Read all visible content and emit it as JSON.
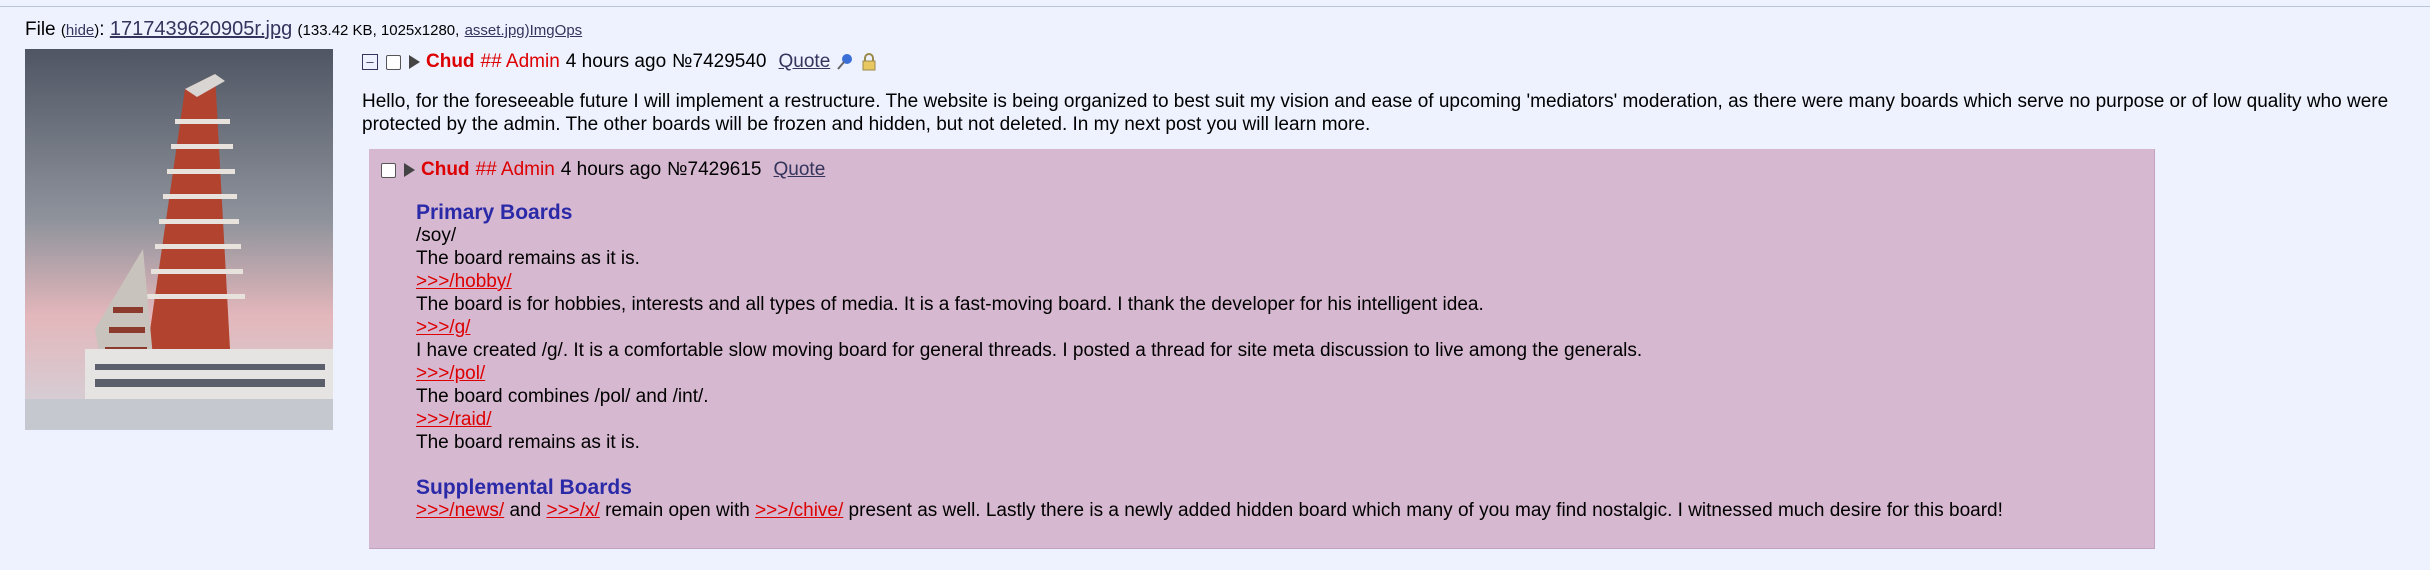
{
  "file": {
    "label": "File",
    "hide_link": "hide",
    "filename": "1717439620905r.jpg",
    "meta": "(133.42 KB, 1025x1280,",
    "asset_link": "asset.jpg)",
    "imgops": "ImgOps"
  },
  "op": {
    "hide_glyph": "–",
    "name": "Chud",
    "capcode": "## Admin",
    "date": "4 hours ago",
    "number": "№7429540",
    "quote_label": "Quote",
    "sticky_icon": "pin-icon",
    "locked_icon": "lock-icon",
    "message": "Hello, for the foreseeable future I will implement a restructure. The website is being organized to best suit my vision and ease of upcoming 'mediators' moderation, as there were many boards which serve no purpose or of low quality who were protected by the admin. The other boards will be frozen and hidden, but not deleted. In my next post you will learn more."
  },
  "reply": {
    "name": "Chud",
    "capcode": "## Admin",
    "date": "4 hours ago",
    "number": "№7429615",
    "quote_label": "Quote",
    "primary_heading": "Primary Boards",
    "soy": "/soy/",
    "soy_desc": "The board remains as it is.",
    "hobby_link": ">>>/hobby/",
    "hobby_desc": "The board is for hobbies, interests and all types of media. It is a fast-moving board. I thank the developer for his intelligent idea.",
    "g_link": ">>>/g/",
    "g_desc": "I have created /g/. It is a comfortable slow moving board for general threads. I posted a thread for site meta discussion to live among the generals.",
    "pol_link": ">>>/pol/",
    "pol_desc": "The board combines /pol/ and /int/.",
    "raid_link": ">>>/raid/",
    "raid_desc": "The board remains as it is.",
    "supplemental_heading": "Supplemental Boards",
    "news_link": ">>>/news/",
    "and_text": " and ",
    "x_link": ">>>/x/",
    "remain_text": " remain open with ",
    "chive_link": ">>>/chive/",
    "closing_text": " present as well. Lastly there is a newly added hidden board which many of you may find nostalgic. I witnessed much desire for this board!"
  },
  "colors": {
    "background": "#eef2ff",
    "reply_background": "#d6b8d0",
    "name": "#dd0000",
    "heading": "#2a2aa8",
    "link": "#34345c"
  }
}
